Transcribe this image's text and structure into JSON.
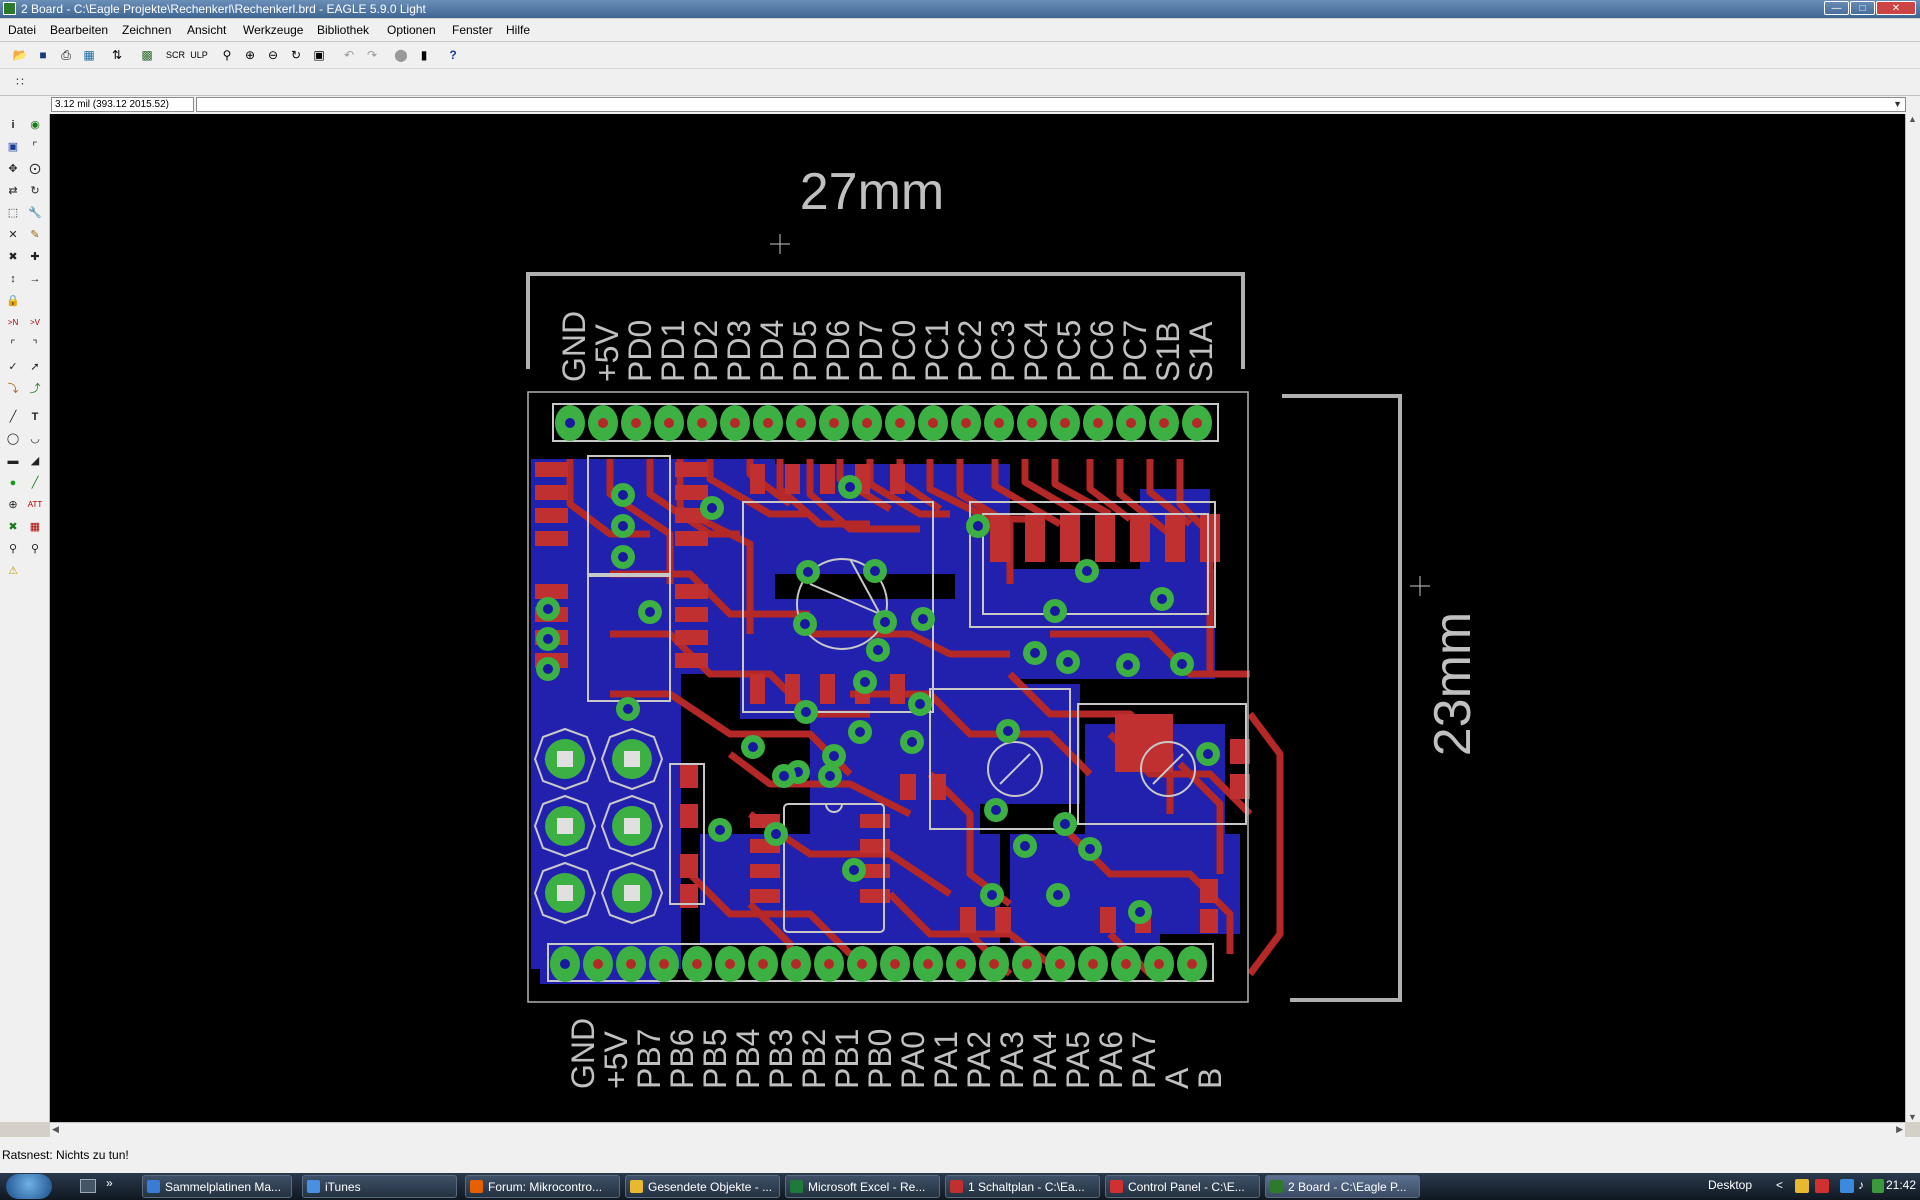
{
  "window": {
    "title": "2 Board - C:\\Eagle Projekte\\Rechenkerl\\Rechenkerl.brd - EAGLE 5.9.0 Light",
    "buttons": [
      "minimize",
      "maximize",
      "close"
    ]
  },
  "menu": [
    "Datei",
    "Bearbeiten",
    "Zeichnen",
    "Ansicht",
    "Werkzeuge",
    "Bibliothek",
    "Optionen",
    "Fenster",
    "Hilfe"
  ],
  "toolbar": {
    "icons": [
      "open-icon",
      "save-icon",
      "print-icon",
      "cam-icon",
      "board-switch-icon",
      "library-icon",
      "script-icon",
      "ulp-icon",
      "zoom-fit-icon",
      "zoom-in-icon",
      "zoom-out-icon",
      "zoom-redraw-icon",
      "zoom-select-icon",
      "undo-icon",
      "redo-icon",
      "stop-icon",
      "go-icon",
      "help-icon"
    ]
  },
  "coordinate": "3.12 mil (393.12 2015.52)",
  "command_input": "",
  "board": {
    "width_label": "27mm",
    "height_label": "23mm",
    "top_header_labels": [
      "GND",
      "+5V",
      "PD0",
      "PD1",
      "PD2",
      "PD3",
      "PD4",
      "PD5",
      "PD6",
      "PD7",
      "PC0",
      "PC1",
      "PC2",
      "PC3",
      "PC4",
      "PC5",
      "PC6",
      "PC7",
      "S1B",
      "S1A"
    ],
    "bottom_header_labels": [
      "GND",
      "+5V",
      "PB7",
      "PB6",
      "PB5",
      "PB4",
      "PB3",
      "PB2",
      "PB1",
      "PB0",
      "PA0",
      "PA1",
      "PA2",
      "PA3",
      "PA4",
      "PA5",
      "PA6",
      "PA7",
      "A",
      "B"
    ],
    "colors": {
      "background": "#000000",
      "top_copper": "#b22222",
      "bottom_copper": "#2020b0",
      "pads": "#3cb043",
      "silkscreen": "#c8c8c8",
      "dimension": "#b0b0b0"
    }
  },
  "status": "Ratsnest: Nichts zu tun!",
  "taskbar": {
    "items": [
      {
        "label": "Sammelplatinen Ma...",
        "color": "#3a7bd5"
      },
      {
        "label": "iTunes",
        "color": "#4a90e2"
      },
      {
        "label": "Forum: Mikrocontro...",
        "color": "#e66000"
      },
      {
        "label": "Gesendete Objekte - ...",
        "color": "#e8b830"
      },
      {
        "label": "Microsoft Excel - Re...",
        "color": "#1d7a3a"
      },
      {
        "label": "1 Schaltplan - C:\\Ea...",
        "color": "#c03030"
      },
      {
        "label": "Control Panel - C:\\E...",
        "color": "#d03030"
      },
      {
        "label": "2 Board - C:\\Eagle P...",
        "color": "#2d7a2d"
      }
    ],
    "desktop_label": "Desktop",
    "clock": "21:42"
  }
}
